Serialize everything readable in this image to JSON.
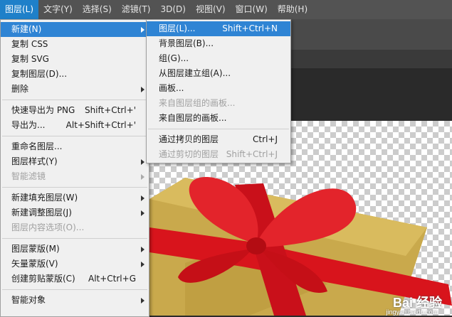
{
  "menubar": [
    "图层(L)",
    "文字(Y)",
    "选择(S)",
    "滤镜(T)",
    "3D(D)",
    "视图(V)",
    "窗口(W)",
    "帮助(H)"
  ],
  "main_menu": {
    "new": "新建(N)",
    "copy_css": "复制 CSS",
    "copy_svg": "复制 SVG",
    "duplicate_layer": "复制图层(D)...",
    "delete": "删除",
    "quick_export": "快速导出为 PNG",
    "quick_export_sc": "Shift+Ctrl+'",
    "export_as": "导出为...",
    "export_as_sc": "Alt+Shift+Ctrl+'",
    "rename_layer": "重命名图层...",
    "layer_style": "图层样式(Y)",
    "smart_filter": "智能滤镜",
    "new_fill_layer": "新建填充图层(W)",
    "new_adjustment_layer": "新建调整图层(J)",
    "layer_content_options": "图层内容选项(O)...",
    "layer_mask": "图层蒙版(M)",
    "vector_mask": "矢量蒙版(V)",
    "create_clipping_mask": "创建剪贴蒙版(C)",
    "create_clipping_mask_sc": "Alt+Ctrl+G",
    "smart_objects": "智能对象"
  },
  "sub_menu": {
    "layer": "图层(L)...",
    "layer_sc": "Shift+Ctrl+N",
    "background_layer": "背景图层(B)...",
    "group": "组(G)...",
    "group_from_layers": "从图层建立组(A)...",
    "artboard": "画板...",
    "artboard_from_group": "来自图层组的画板...",
    "artboard_from_layers": "来自图层的画板...",
    "layer_via_copy": "通过拷贝的图层",
    "layer_via_copy_sc": "Ctrl+J",
    "layer_via_cut": "通过剪切的图层",
    "layer_via_cut_sc": "Shift+Ctrl+J"
  },
  "watermark": {
    "brand": "Bai 经验",
    "url": "jingyan.baidu.com"
  },
  "colors": {
    "menubar_bg": "#535353",
    "menu_highlight": "#2f84d4",
    "gift_box": "#c9a94c",
    "ribbon": "#d8141c"
  }
}
